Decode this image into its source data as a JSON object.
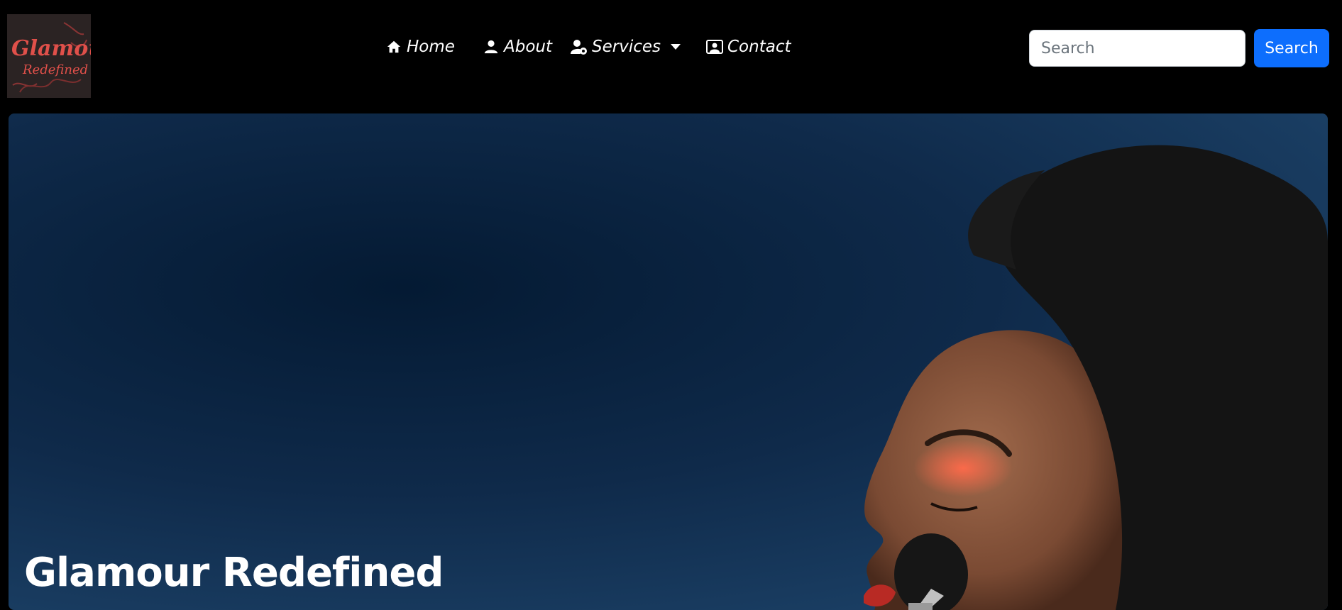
{
  "brand": {
    "logo_text_line1": "Glamour",
    "logo_text_line2": "Redefined"
  },
  "nav": {
    "items": [
      {
        "label": "Home",
        "icon": "home-icon"
      },
      {
        "label": "About",
        "icon": "person-icon"
      },
      {
        "label": "Services",
        "icon": "user-gear-icon",
        "dropdown": true
      },
      {
        "label": "Contact",
        "icon": "contact-card-icon"
      }
    ]
  },
  "search": {
    "placeholder": "Search",
    "value": "",
    "button_label": "Search"
  },
  "hero": {
    "title": "Glamour Redefined"
  },
  "colors": {
    "navbar_bg": "#000000",
    "search_button": "#0d6efd",
    "hero_bg": "#1a3e63",
    "logo_text": "#e0504a"
  }
}
